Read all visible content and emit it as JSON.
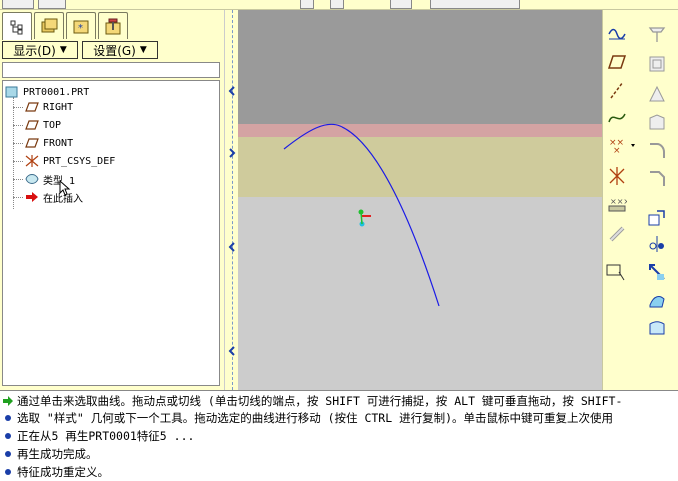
{
  "left_panel": {
    "menus": {
      "show_label": "显示(D)",
      "settings_label": "设置(G)"
    },
    "tree": {
      "root": "PRT0001.PRT",
      "items": [
        {
          "label": "RIGHT",
          "icon": "datum-plane-icon"
        },
        {
          "label": "TOP",
          "icon": "datum-plane-icon"
        },
        {
          "label": "FRONT",
          "icon": "datum-plane-icon"
        },
        {
          "label": "PRT_CSYS_DEF",
          "icon": "coordinate-system-icon"
        },
        {
          "label": "类型 1",
          "icon": "style-feature-icon"
        },
        {
          "label": "在此插入",
          "icon": "insert-here-arrow-icon"
        }
      ]
    }
  },
  "graphics": {
    "colors": {
      "background": "#cccccc",
      "top_band": "#9a9a9a",
      "pink_band": "#d4a3a3",
      "yellow_band": "#cfcb9c",
      "curve": "#1a1ae6"
    }
  },
  "messages": [
    {
      "icon": "green-arrow-icon",
      "text": "通过单击来选取曲线。拖动点或切线 (单击切线的端点，按 SHIFT 可进行捕捉，按 ALT 键可垂直拖动，按 SHIFT-"
    },
    {
      "icon": "blue-bullet-icon",
      "text": "选取 \"样式\" 几何或下一个工具。拖动选定的曲线进行移动 (按住 CTRL 进行复制)。单击鼠标中键可重复上次使用"
    },
    {
      "icon": "blue-bullet-icon",
      "text": "正在从5 再生PRT0001特征5 ..."
    },
    {
      "icon": "blue-bullet-icon",
      "text": "再生成功完成。"
    },
    {
      "icon": "blue-bullet-icon",
      "text": "特征成功重定义。"
    }
  ]
}
